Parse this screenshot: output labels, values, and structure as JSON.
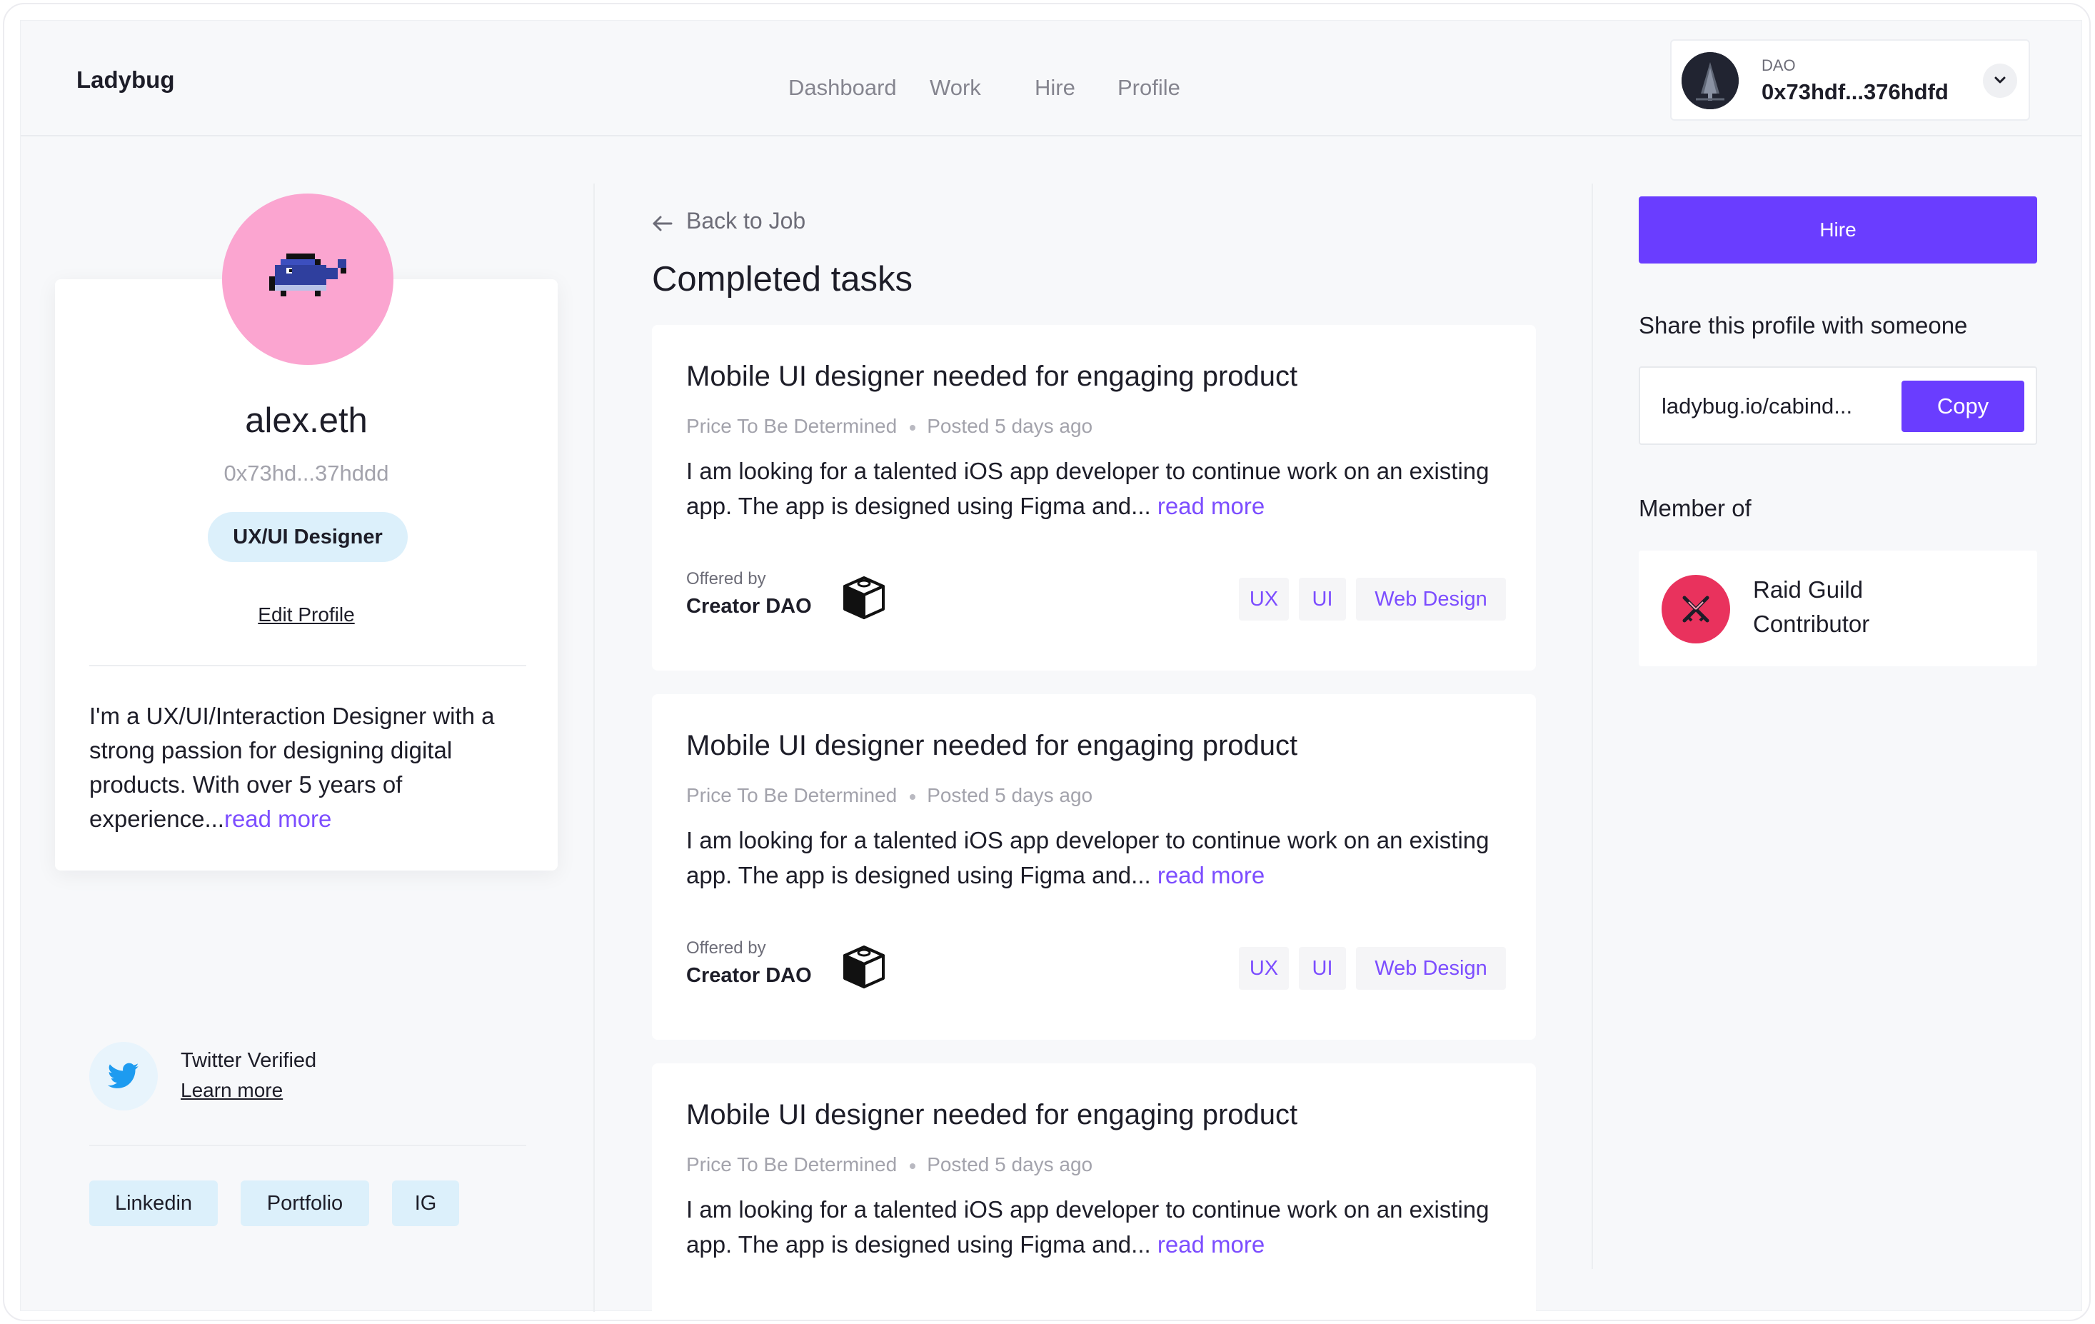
{
  "app": {
    "logo": "Ladybug"
  },
  "nav": {
    "items": [
      "Dashboard",
      "Work",
      "Hire",
      "Profile"
    ]
  },
  "wallet": {
    "label": "DAO",
    "address": "0x73hdf...376hdfd",
    "icon": "tree-avatar-icon"
  },
  "profile": {
    "name": "alex.eth",
    "address": "0x73hd...37hddd",
    "role": "UX/UI Designer",
    "edit_label": "Edit Profile",
    "bio": "I'm a UX/UI/Interaction Designer with a strong passion for designing digital products. With over 5 years of experience...",
    "bio_read_more": "read more",
    "verification": {
      "label": "Twitter Verified",
      "link": "Learn more",
      "icon": "twitter-icon"
    },
    "social_links": [
      "Linkedin",
      "Portfolio",
      "IG"
    ],
    "avatar_bg": "#fba5d0"
  },
  "main": {
    "back_label": "Back to Job",
    "title": "Completed tasks",
    "tasks": [
      {
        "title": "Mobile UI designer needed for engaging product",
        "price": "Price To Be Determined",
        "posted": "Posted 5 days ago",
        "description": "I am looking for a talented iOS app developer to continue work on an existing app. The app is designed using Figma and...",
        "read_more": " read more",
        "offered_by_label": "Offered by",
        "offered_by": "Creator DAO",
        "tags": [
          "UX",
          "UI",
          "Web Design"
        ]
      },
      {
        "title": "Mobile UI designer needed for engaging product",
        "price": "Price To Be Determined",
        "posted": "Posted 5 days ago",
        "description": "I am looking for a talented iOS app developer to continue work on an existing app. The app is designed using Figma and...",
        "read_more": " read more",
        "offered_by_label": "Offered by",
        "offered_by": "Creator DAO",
        "tags": [
          "UX",
          "UI",
          "Web Design"
        ]
      },
      {
        "title": "Mobile UI designer needed for engaging product",
        "price": "Price To Be Determined",
        "posted": "Posted 5 days ago",
        "description": "I am looking for a talented iOS app developer to continue work on an existing app. The app is designed using Figma and...",
        "read_more": " read more"
      }
    ]
  },
  "sidebar": {
    "hire_label": "Hire",
    "share_label": "Share this profile with someone",
    "share_url": "ladybug.io/cabind...",
    "copy_label": "Copy",
    "member_label": "Member of",
    "member": {
      "name": "Raid Guild",
      "role": "Contributor",
      "icon": "raid-guild-swords-icon"
    }
  },
  "colors": {
    "accent": "#6a3dff",
    "link": "#7c4dff",
    "pill": "#dcf0fb",
    "guild": "#e9325d"
  }
}
